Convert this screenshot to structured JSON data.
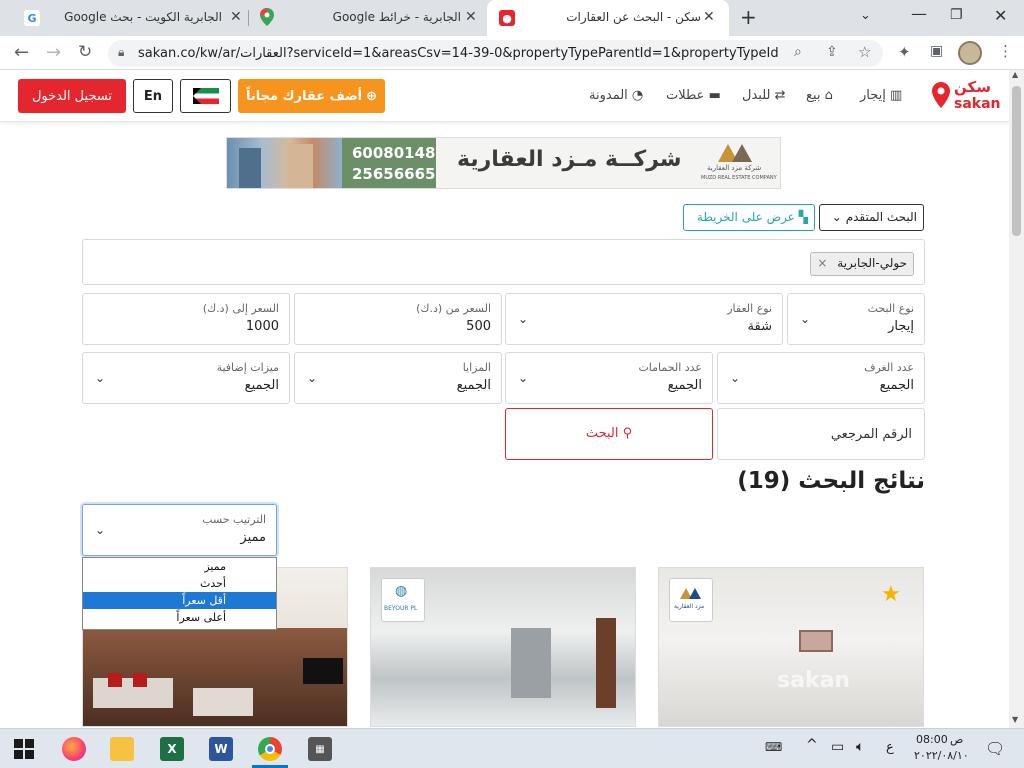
{
  "browser": {
    "tabs": [
      {
        "title": "الجابرية الكويت - بحث Google"
      },
      {
        "title": "الجابرية - خرائط Google"
      },
      {
        "title": "سكن - البحث عن العقارات"
      }
    ],
    "url": "sakan.co/kw/ar/العقارات?serviceId=1&areasCsv=14-39-0&propertyTypeParentId=1&propertyTypeId=...",
    "new_tab": "+",
    "win_min": "⌄"
  },
  "site": {
    "logo_ar": "سكن",
    "logo_en": "sakan",
    "nav": {
      "rent": "إيجار",
      "sale": "بيع",
      "exchange": "للبدل",
      "holidays": "عطلات",
      "blog": "المدونة"
    },
    "add_property": "أضف عقارك مجاناً",
    "lang": "En",
    "login": "تسجيل الدخول"
  },
  "banner": {
    "company": "شركــة مـزد العقارية",
    "phone1": "60080148",
    "phone2": "25656665",
    "company_en": "MUZD REAL ESTATE COMPANY",
    "company_ar_small": "شركة مزد العقارية"
  },
  "search": {
    "advanced": "البحث المتقدم",
    "map_view": "عرض على الخريطة",
    "area_tag": "حولي-الجابرية",
    "tag_remove": "×",
    "filters": {
      "search_type_label": "نوع البحث",
      "search_type_value": "إيجار",
      "property_type_label": "نوع العقار",
      "property_type_value": "شقة",
      "price_from_label": "السعر من (د.ك)",
      "price_from_value": "500",
      "price_to_label": "السعر إلى (د.ك)",
      "price_to_value": "1000",
      "rooms_label": "عدد الغرف",
      "rooms_value": "الجميع",
      "baths_label": "عدد الحمامات",
      "baths_value": "الجميع",
      "features_label": "المزايا",
      "features_value": "الجميع",
      "extra_label": "ميزات إضافية",
      "extra_value": "الجميع",
      "ref_placeholder": "الرقم المرجعي",
      "search_button": "البحث"
    }
  },
  "results": {
    "title": "نتائج البحث (19)",
    "sort_label": "الترتيب حسب",
    "sort_value": "مميز",
    "sort_options": [
      "مميز",
      "أحدث",
      "أقل سعراً",
      "أعلى سعراً"
    ],
    "watermark": "sakan",
    "card_logo_text": "مزد العقارية",
    "card2_logo_text": "BEYOUR PL"
  },
  "taskbar": {
    "time": "08:00",
    "ampm": "ص",
    "date": "٢٠٢٢/٠٨/١٠",
    "lang": "ع",
    "ellipsis": "..."
  },
  "colors": {
    "brand_red": "#e5262f",
    "add_orange": "#f7941d",
    "teal": "#26a7a7",
    "select_blue": "#1e79d6"
  }
}
